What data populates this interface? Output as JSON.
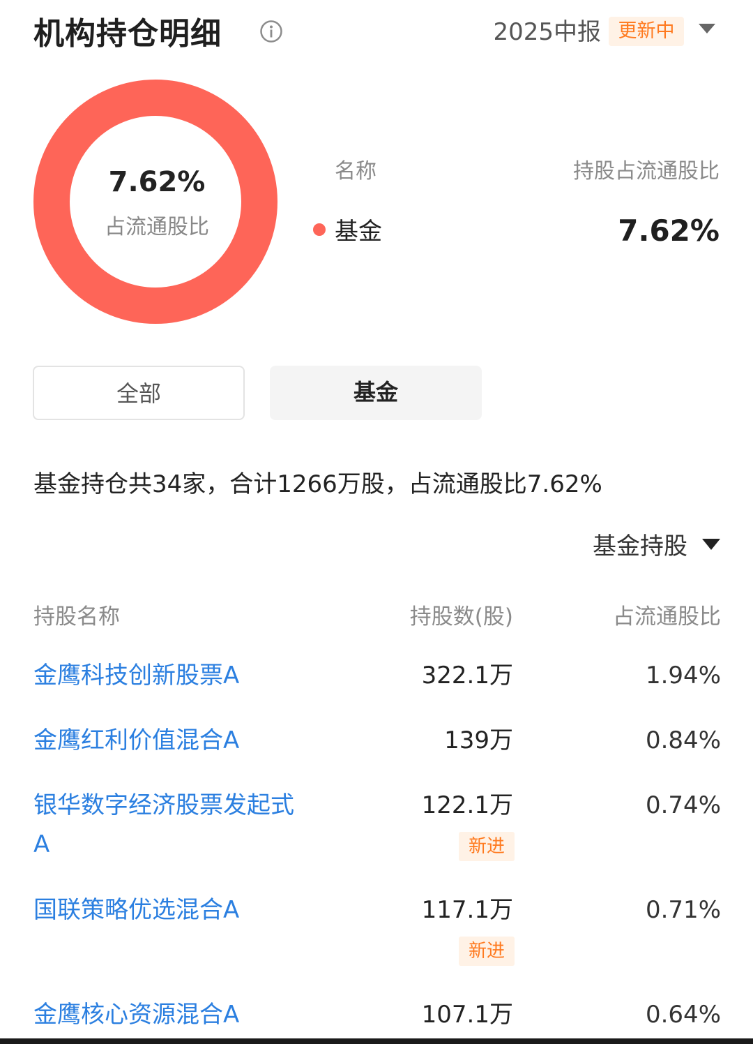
{
  "header": {
    "title": "机构持仓明细",
    "period": "2025中报",
    "update_badge": "更新中"
  },
  "colors": {
    "fund": "#fe6558",
    "link": "#2b7fe0",
    "badge_text": "#ff7a1f",
    "badge_bg": "#fff2e6"
  },
  "chart_data": {
    "type": "pie",
    "center_value": "7.62%",
    "center_label": "占流通股比",
    "slices": [
      {
        "name": "基金",
        "value": 7.62,
        "color": "#fe6558"
      }
    ]
  },
  "legend": {
    "col_name": "名称",
    "col_ratio": "持股占流通股比",
    "items": [
      {
        "name": "基金",
        "value": "7.62%"
      }
    ]
  },
  "filters": {
    "all_label": "全部",
    "fund_label": "基金",
    "selected": "基金"
  },
  "summary": "基金持仓共34家，合计1266万股，占流通股比7.62%",
  "sort": {
    "label": "基金持股"
  },
  "table": {
    "headers": {
      "name": "持股名称",
      "shares": "持股数(股)",
      "ratio": "占流通股比"
    },
    "rows": [
      {
        "name": "金鹰科技创新股票A",
        "shares": "322.1万",
        "ratio": "1.94%",
        "badge": ""
      },
      {
        "name": "金鹰红利价值混合A",
        "shares": "139万",
        "ratio": "0.84%",
        "badge": ""
      },
      {
        "name": "银华数字经济股票发起式A",
        "shares": "122.1万",
        "ratio": "0.74%",
        "badge": "新进"
      },
      {
        "name": "国联策略优选混合A",
        "shares": "117.1万",
        "ratio": "0.71%",
        "badge": "新进"
      },
      {
        "name": "金鹰核心资源混合A",
        "shares": "107.1万",
        "ratio": "0.64%",
        "badge": ""
      }
    ]
  }
}
